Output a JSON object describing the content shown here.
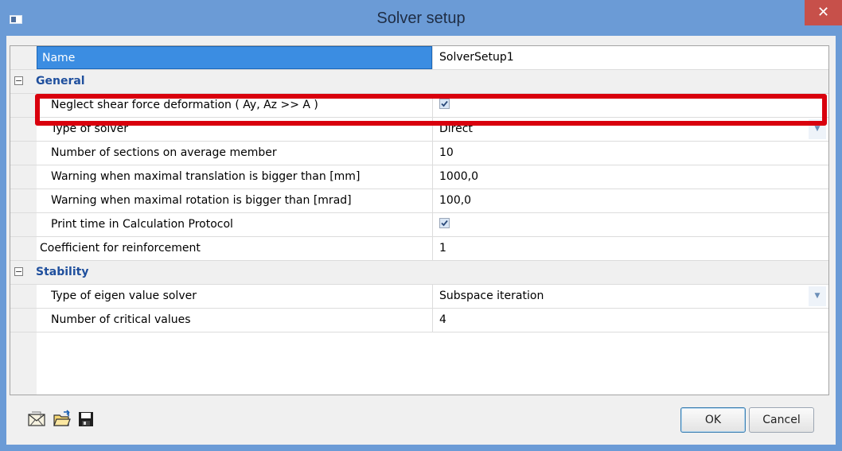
{
  "window": {
    "title": "Solver setup"
  },
  "grid": {
    "name_row": {
      "label": "Name",
      "value": "SolverSetup1"
    },
    "sections": [
      {
        "label": "General",
        "rows": [
          {
            "label": "Neglect shear force deformation ( Ay, Az >> A )",
            "type": "checkbox",
            "checked": true
          },
          {
            "label": "Type of solver",
            "type": "dropdown",
            "value": "Direct"
          },
          {
            "label": "Number of sections on average member",
            "type": "text",
            "value": "10"
          },
          {
            "label": "Warning when maximal translation is bigger than [mm]",
            "type": "text",
            "value": "1000,0"
          },
          {
            "label": "Warning when maximal rotation is bigger than [mrad]",
            "type": "text",
            "value": "100,0"
          },
          {
            "label": "Print time in Calculation Protocol",
            "type": "checkbox",
            "checked": true
          }
        ]
      },
      {
        "label": "Stability",
        "rows": [
          {
            "label": "Type of eigen value solver",
            "type": "dropdown",
            "value": "Subspace iteration"
          },
          {
            "label": "Number of critical values",
            "type": "text",
            "value": "4"
          }
        ]
      }
    ],
    "toplevel_row": {
      "label": "Coefficient for reinforcement",
      "value": "1"
    }
  },
  "footer": {
    "icons": [
      "mail-icon",
      "open-folder-icon",
      "save-icon"
    ],
    "ok_label": "OK",
    "cancel_label": "Cancel"
  },
  "colors": {
    "titlebar": "#6b9bd6",
    "selection": "#3b8de2",
    "section_text": "#1f4f9d",
    "highlight": "#d9000d",
    "close_button": "#c7504a"
  }
}
